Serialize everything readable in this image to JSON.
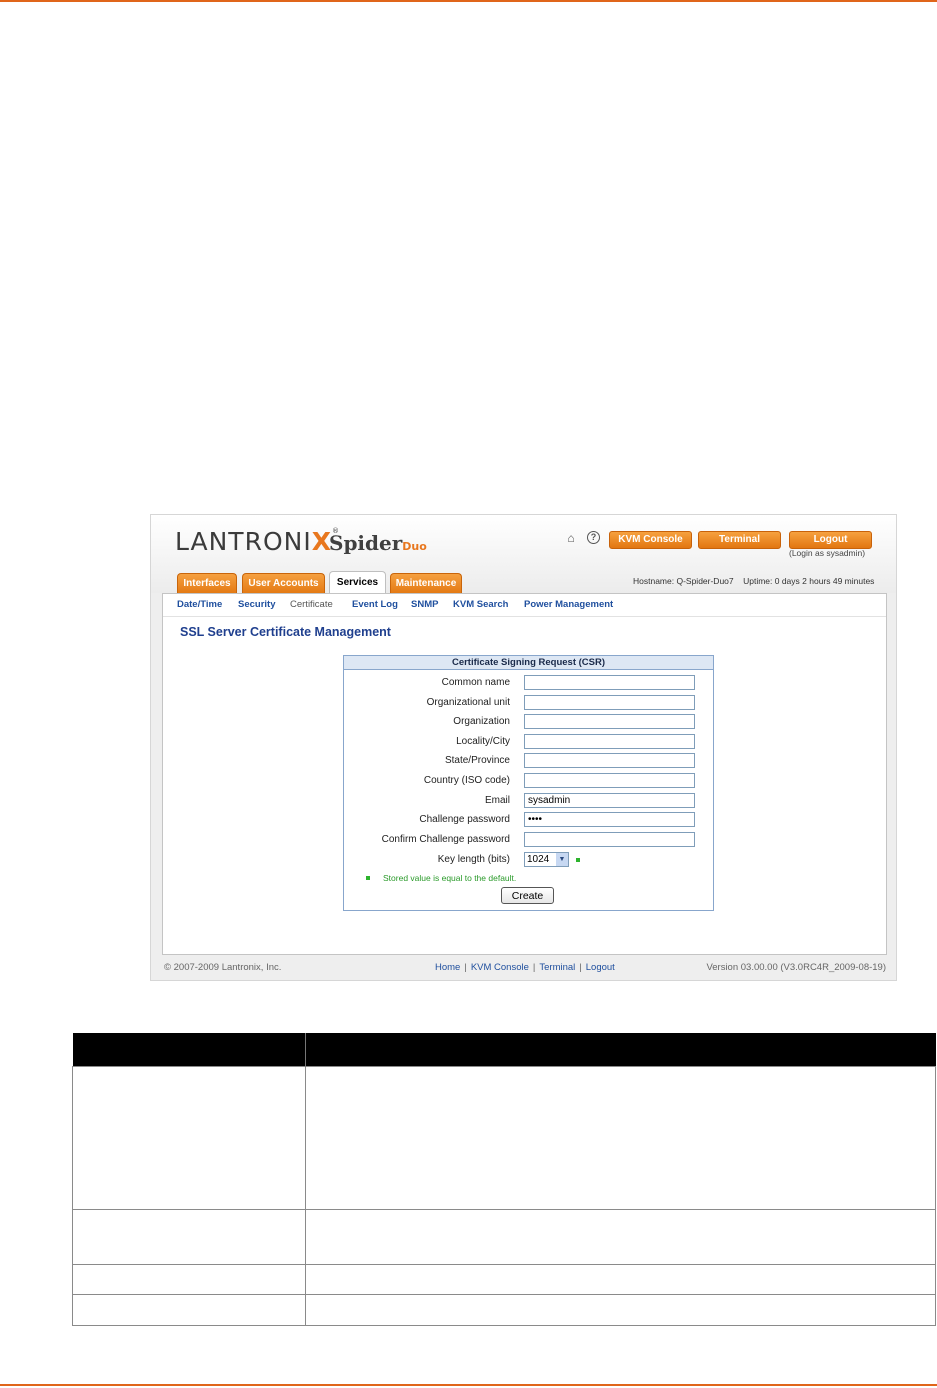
{
  "brand": {
    "company": "LANTRONIX",
    "product": "Spider",
    "product_suffix": "Duo"
  },
  "header": {
    "kvm_console_button": "KVM Console",
    "terminal_button": "Terminal",
    "logout_button": "Logout",
    "login_as": "(Login as sysadmin)",
    "hostname": "Hostname: Q-Spider-Duo7",
    "uptime": "Uptime: 0 days 2 hours 49 minutes"
  },
  "tabs": [
    {
      "label": "Interfaces",
      "active": false
    },
    {
      "label": "User Accounts",
      "active": false
    },
    {
      "label": "Services",
      "active": true
    },
    {
      "label": "Maintenance",
      "active": false
    }
  ],
  "subnav": [
    "Date/Time",
    "Security",
    "Certificate",
    "Event Log",
    "SNMP",
    "KVM Search",
    "Power Management"
  ],
  "page_title": "SSL Server Certificate Management",
  "csr": {
    "title": "Certificate Signing Request (CSR)",
    "fields": [
      {
        "label": "Common name",
        "value": ""
      },
      {
        "label": "Organizational unit",
        "value": ""
      },
      {
        "label": "Organization",
        "value": ""
      },
      {
        "label": "Locality/City",
        "value": ""
      },
      {
        "label": "State/Province",
        "value": ""
      },
      {
        "label": "Country (ISO code)",
        "value": ""
      },
      {
        "label": "Email",
        "value": "sysadmin"
      },
      {
        "label": "Challenge password",
        "value": "••••"
      },
      {
        "label": "Confirm Challenge password",
        "value": ""
      }
    ],
    "key_length_label": "Key length (bits)",
    "key_length_value": "1024",
    "stored_note": "Stored value is equal to the default.",
    "create_button": "Create"
  },
  "footer": {
    "copyright": "© 2007-2009 Lantronix, Inc.",
    "links": [
      "Home",
      "KVM Console",
      "Terminal",
      "Logout"
    ],
    "version": "Version 03.00.00 (V3.0RC4R_2009-08-19)"
  },
  "colors": {
    "accent_orange": "#e27611",
    "link_blue": "#1f4f9e",
    "rule": "#e0651a"
  }
}
